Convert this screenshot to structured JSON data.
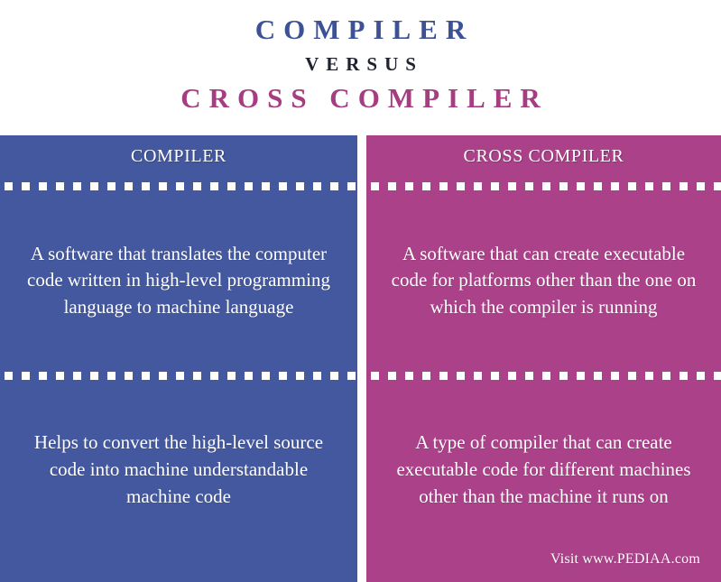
{
  "title": {
    "top": "COMPILER",
    "middle": "VERSUS",
    "bottom": "CROSS COMPILER",
    "color_top": "#3d5295",
    "color_middle": "#20232e",
    "color_bottom": "#a63d80"
  },
  "comparison": {
    "left": {
      "header": "COMPILER",
      "accent_color": "#44589f",
      "rows": [
        "A software that translates the computer code written in high-level programming language to machine language",
        "Helps to convert the high-level source code into machine understandable machine code"
      ]
    },
    "right": {
      "header": "CROSS COMPILER",
      "accent_color": "#ab4189",
      "rows": [
        "A software that can create executable code for platforms other than the one on which the compiler is running",
        "A type of compiler that can create executable code for different machines other than the machine it runs on"
      ]
    }
  },
  "footer": {
    "credit": "Visit www.PEDIAA.com"
  }
}
